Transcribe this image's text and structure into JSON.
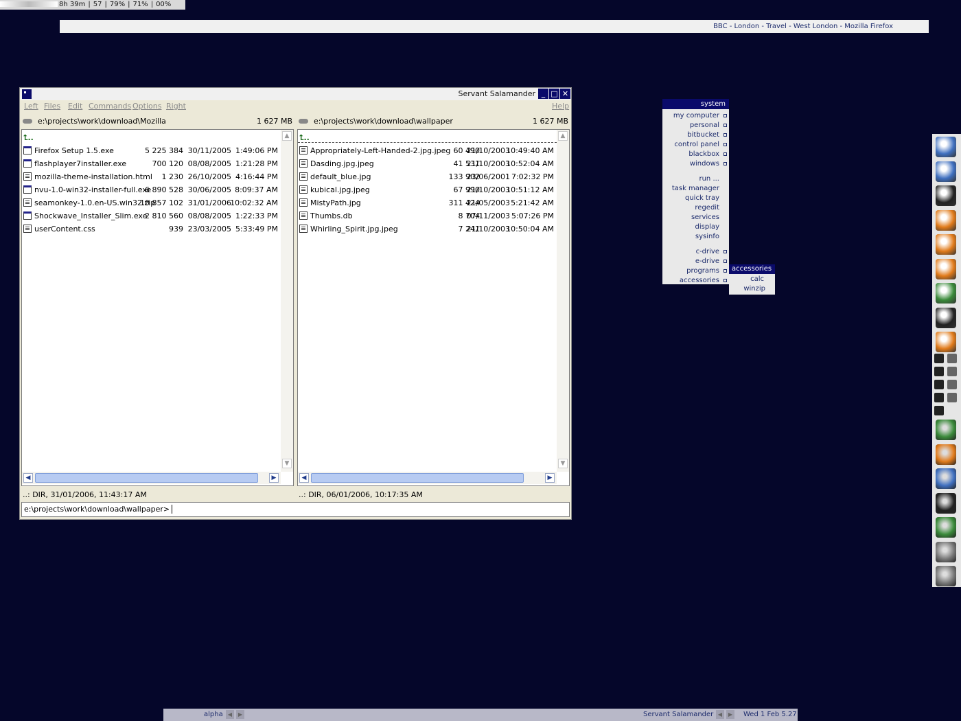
{
  "statusbar": {
    "segments": [
      "8h 39m",
      "57",
      "79%",
      "71%",
      "00%"
    ]
  },
  "firefox_title": "BBC - London - Travel - West London - Mozilla Firefox",
  "window": {
    "title": "Servant Salamander",
    "menu": [
      "Left",
      "Files",
      "Edit",
      "Commands",
      "Options",
      "Right"
    ],
    "help": "Help",
    "left": {
      "path": "e:\\projects\\work\\download\\Mozilla",
      "free": "1 627 MB",
      "up": "⮤..",
      "files": [
        {
          "name": "Firefox Setup 1.5.exe",
          "size": "5 225 384",
          "date": "30/11/2005",
          "time": "1:49:06 PM",
          "type": "exe"
        },
        {
          "name": "flashplayer7installer.exe",
          "size": "700 120",
          "date": "08/08/2005",
          "time": "1:21:28 PM",
          "type": "exe"
        },
        {
          "name": "mozilla-theme-installation.html",
          "size": "1 230",
          "date": "26/10/2005",
          "time": "4:16:44 PM",
          "type": "doc"
        },
        {
          "name": "nvu-1.0-win32-installer-full.exe",
          "size": "6 890 528",
          "date": "30/06/2005",
          "time": "8:09:37 AM",
          "type": "exe"
        },
        {
          "name": "seamonkey-1.0.en-US.win32.zip",
          "size": "10 857 102",
          "date": "31/01/2006",
          "time": "10:02:32 AM",
          "type": "doc"
        },
        {
          "name": "Shockwave_Installer_Slim.exe",
          "size": "2 810 560",
          "date": "08/08/2005",
          "time": "1:22:33 PM",
          "type": "exe"
        },
        {
          "name": "userContent.css",
          "size": "939",
          "date": "23/03/2005",
          "time": "5:33:49 PM",
          "type": "doc"
        }
      ],
      "status": "..: DIR, 31/01/2006, 11:43:17 AM"
    },
    "right": {
      "path": "e:\\projects\\work\\download\\wallpaper",
      "free": "1 627 MB",
      "up": "⮤..",
      "files": [
        {
          "name": "Appropriately-Left-Handed-2.jpg.jpeg",
          "size": "60 490",
          "date": "21/10/2003",
          "time": "10:49:40 AM",
          "type": "doc"
        },
        {
          "name": "Dasding.jpg.jpeg",
          "size": "41 531",
          "date": "21/10/2003",
          "time": "10:52:04 AM",
          "type": "doc"
        },
        {
          "name": "default_blue.jpg",
          "size": "133 902",
          "date": "23/06/2001",
          "time": "7:02:32 PM",
          "type": "doc"
        },
        {
          "name": "kubical.jpg.jpeg",
          "size": "67 990",
          "date": "21/10/2003",
          "time": "10:51:12 AM",
          "type": "doc"
        },
        {
          "name": "MistyPath.jpg",
          "size": "311 424",
          "date": "21/05/2003",
          "time": "5:21:42 AM",
          "type": "doc"
        },
        {
          "name": "Thumbs.db",
          "size": "8 704",
          "date": "07/11/2003",
          "time": "5:07:26 PM",
          "type": "doc"
        },
        {
          "name": "Whirling_Spirit.jpg.jpeg",
          "size": "7 241",
          "date": "21/10/2003",
          "time": "10:50:04 AM",
          "type": "doc"
        }
      ],
      "status": "..: DIR, 06/01/2006, 10:17:35 AM"
    },
    "command_line": "e:\\projects\\work\\download\\wallpaper>"
  },
  "menu": {
    "header": "system",
    "groups": [
      [
        {
          "label": "my computer",
          "sub": true
        },
        {
          "label": "personal",
          "sub": true
        },
        {
          "label": "bitbucket",
          "sub": true
        },
        {
          "label": "control panel",
          "sub": true
        },
        {
          "label": "blackbox",
          "sub": true
        },
        {
          "label": "windows",
          "sub": true
        }
      ],
      [
        {
          "label": "run ...",
          "sub": false
        },
        {
          "label": "task manager",
          "sub": false
        },
        {
          "label": "quick tray",
          "sub": false
        },
        {
          "label": "regedit",
          "sub": false
        },
        {
          "label": "services",
          "sub": false
        },
        {
          "label": "display",
          "sub": false
        },
        {
          "label": "sysinfo",
          "sub": false
        }
      ],
      [
        {
          "label": "c-drive",
          "sub": true
        },
        {
          "label": "e-drive",
          "sub": true
        },
        {
          "label": "programs",
          "sub": true
        },
        {
          "label": "accessories",
          "sub": true
        }
      ]
    ]
  },
  "submenu": {
    "header": "accessories",
    "items": [
      "calc",
      "winzip"
    ]
  },
  "taskbar": {
    "workspace": "alpha",
    "task": "Servant Salamander",
    "clock": "Wed 1 Feb 5.27"
  },
  "dock": {
    "large_top": [
      "network-icon",
      "computer-icon",
      "terminal-icon",
      "folder-icon",
      "clock-icon",
      "star-icon",
      "windows-update-icon",
      "console-icon",
      "star-globe-icon"
    ],
    "small_rows": [
      [
        "mouse-icon",
        "disc-icon"
      ],
      [
        "n-icon",
        "keyboard-icon"
      ],
      [
        "vc-icon",
        "shield-icon"
      ],
      [
        "shield-v-icon",
        "round-icon"
      ],
      [
        "pen-icon"
      ]
    ],
    "large_bottom": [
      "chat-icon",
      "firefox-icon",
      "eclipse-icon",
      "skater-icon",
      "calculator-icon",
      "gimp-icon",
      "gimp-2-icon"
    ],
    "colors": {
      "blue": "#3f6fbf",
      "orange": "#e07a1a",
      "green": "#3a8a3a",
      "dark": "#222"
    }
  }
}
